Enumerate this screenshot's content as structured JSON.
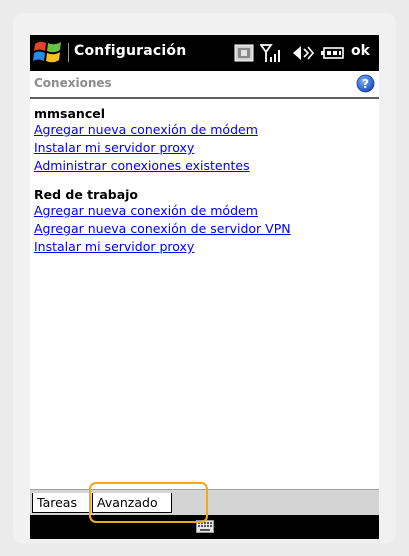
{
  "titlebar": {
    "title": "Configuración",
    "ok_label": "ok",
    "icons": [
      "windows-start-icon",
      "sim-card-icon",
      "signal-icon",
      "volume-icon",
      "battery-icon"
    ]
  },
  "header": {
    "title": "Conexiones",
    "help_icon": "help-icon"
  },
  "sections": [
    {
      "title": "mmsancel",
      "links": [
        "Agregar nueva conexión de módem",
        "Instalar mi servidor proxy",
        "Administrar conexiones existentes"
      ]
    },
    {
      "title": "Red de trabajo",
      "links": [
        "Agregar nueva conexión de módem",
        "Agregar nueva conexión de servidor VPN",
        "Instalar mi servidor proxy"
      ]
    }
  ],
  "tabs": [
    {
      "label": "Tareas",
      "selected": true
    },
    {
      "label": "Avanzado",
      "selected": false
    }
  ],
  "bottombar": {
    "keyboard_icon": "keyboard-icon"
  },
  "colors": {
    "link": "#0000ff",
    "highlight": "#f0a820",
    "titlebar": "#000000"
  }
}
